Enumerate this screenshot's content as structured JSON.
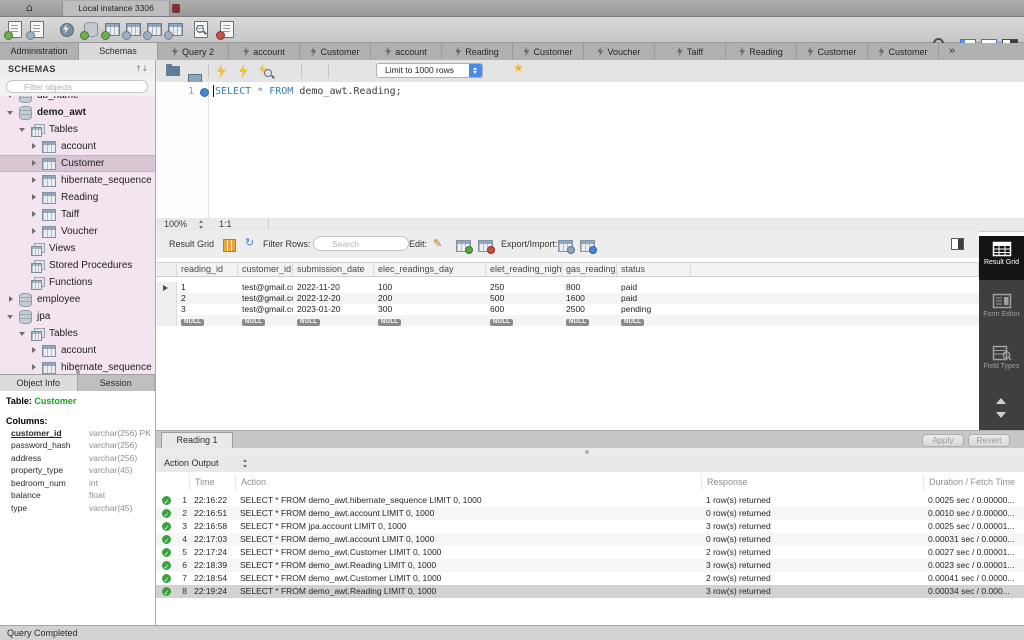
{
  "titlebar": {
    "window_tab": "Local instance 3306"
  },
  "icons": {
    "home": "⌂",
    "sort_arrows": "↑↓",
    "refresh": "↻",
    "star": "★",
    "pencil": "✎",
    "pilcrow": "¶",
    "check": "✓"
  },
  "tabbar": {
    "tabs": [
      "Administration",
      "Schemas",
      "Query 2",
      "account",
      "Customer",
      "account",
      "Reading",
      "Customer",
      "Voucher",
      "Taiff",
      "Reading",
      "Customer",
      "Customer"
    ],
    "overflow": "»"
  },
  "sidebar": {
    "title": "SCHEMAS",
    "filter_placeholder": "Filter objects",
    "tree": [
      {
        "label": "db_name"
      },
      {
        "label": "demo_awt"
      },
      {
        "label": "Tables"
      },
      {
        "label": "account"
      },
      {
        "label": "Customer"
      },
      {
        "label": "hibernate_sequence"
      },
      {
        "label": "Reading"
      },
      {
        "label": "Taiff"
      },
      {
        "label": "Voucher"
      },
      {
        "label": "Views"
      },
      {
        "label": "Stored Procedures"
      },
      {
        "label": "Functions"
      },
      {
        "label": "employee"
      },
      {
        "label": "jpa"
      },
      {
        "label": "Tables"
      },
      {
        "label": "account"
      },
      {
        "label": "hibernate_sequence"
      }
    ],
    "panel_tabs": [
      "Object Info",
      "Session"
    ],
    "object_info": {
      "table_label": "Table:",
      "table_name": "Customer",
      "columns_label": "Columns:",
      "columns": [
        {
          "name": "customer_id",
          "type": "varchar(256) PK"
        },
        {
          "name": "password_hash",
          "type": "varchar(256)"
        },
        {
          "name": "address",
          "type": "varchar(256)"
        },
        {
          "name": "property_type",
          "type": "varchar(45)"
        },
        {
          "name": "bedroom_num",
          "type": "int"
        },
        {
          "name": "balance",
          "type": "float"
        },
        {
          "name": "type",
          "type": "varchar(45)"
        }
      ]
    }
  },
  "editor_toolbar": {
    "limit_dropdown": "Limit to 1000 rows"
  },
  "editor": {
    "line_number": "1",
    "sql_keyword1": "SELECT",
    "sql_star": "*",
    "sql_keyword2": "FROM",
    "sql_rest": "demo_awt.Reading;",
    "zoom": "100%",
    "caret_pos": "1:1"
  },
  "result_grid": {
    "toolbar": {
      "title": "Result Grid",
      "filter_label": "Filter Rows:",
      "search_placeholder": "Search",
      "edit_label": "Edit:",
      "export_label": "Export/Import:"
    },
    "columns": [
      "reading_id",
      "customer_id",
      "submission_date",
      "elec_readings_day",
      "elet_reading_night",
      "gas_reading",
      "status"
    ],
    "rows": [
      [
        "1",
        "test@gmail.com",
        "2022-11-20",
        "100",
        "250",
        "800",
        "paid"
      ],
      [
        "2",
        "test@gmail.com",
        "2022-12-20",
        "200",
        "500",
        "1600",
        "paid"
      ],
      [
        "3",
        "test@gmail.com",
        "2023-01-20",
        "300",
        "600",
        "2500",
        "pending"
      ]
    ],
    "null_text": "NULL",
    "result_tab": "Reading 1",
    "apply_label": "Apply",
    "revert_label": "Revert"
  },
  "side_panel": {
    "items": [
      {
        "label": "Result Grid"
      },
      {
        "label": "Form Editor"
      },
      {
        "label": "Field Types"
      }
    ]
  },
  "action_output": {
    "title": "Action Output",
    "columns": {
      "time": "Time",
      "action": "Action",
      "response": "Response",
      "duration": "Duration / Fetch Time"
    },
    "rows": [
      {
        "index": "1",
        "time": "22:16:22",
        "action": "SELECT * FROM demo_awt.hibernate_sequence LIMIT 0, 1000",
        "response": "1 row(s) returned",
        "duration": "0.0025 sec / 0.00000..."
      },
      {
        "index": "2",
        "time": "22:16:51",
        "action": "SELECT * FROM demo_awt.account LIMIT 0, 1000",
        "response": "0 row(s) returned",
        "duration": "0.0010 sec / 0.00000..."
      },
      {
        "index": "3",
        "time": "22:16:58",
        "action": "SELECT * FROM jpa.account LIMIT 0, 1000",
        "response": "3 row(s) returned",
        "duration": "0.0025 sec / 0.00001..."
      },
      {
        "index": "4",
        "time": "22:17:03",
        "action": "SELECT * FROM demo_awt.account LIMIT 0, 1000",
        "response": "0 row(s) returned",
        "duration": "0.00031 sec / 0.0000..."
      },
      {
        "index": "5",
        "time": "22:17:24",
        "action": "SELECT * FROM demo_awt.Customer LIMIT 0, 1000",
        "response": "2 row(s) returned",
        "duration": "0.0027 sec / 0.00001..."
      },
      {
        "index": "6",
        "time": "22:18:39",
        "action": "SELECT * FROM demo_awt.Reading LIMIT 0, 1000",
        "response": "3 row(s) returned",
        "duration": "0.0023 sec / 0.00001..."
      },
      {
        "index": "7",
        "time": "22:18:54",
        "action": "SELECT * FROM demo_awt.Customer LIMIT 0, 1000",
        "response": "2 row(s) returned",
        "duration": "0.00041 sec / 0.0000..."
      },
      {
        "index": "8",
        "time": "22:19:24",
        "action": "SELECT * FROM demo_awt.Reading LIMIT 0, 1000",
        "response": "3 row(s) returned",
        "duration": "0.00034 sec / 0.000..."
      }
    ]
  },
  "statusbar": {
    "text": "Query Completed"
  },
  "colors": {
    "accent_blue": "#4a8ae8",
    "schema_pink": "#f2e5ef",
    "selection_pink": "#d8c5d4",
    "table_name_green": "#1ba227",
    "keyword_blue": "#3a7dbd",
    "panel_dark": "#3f3f3f"
  }
}
